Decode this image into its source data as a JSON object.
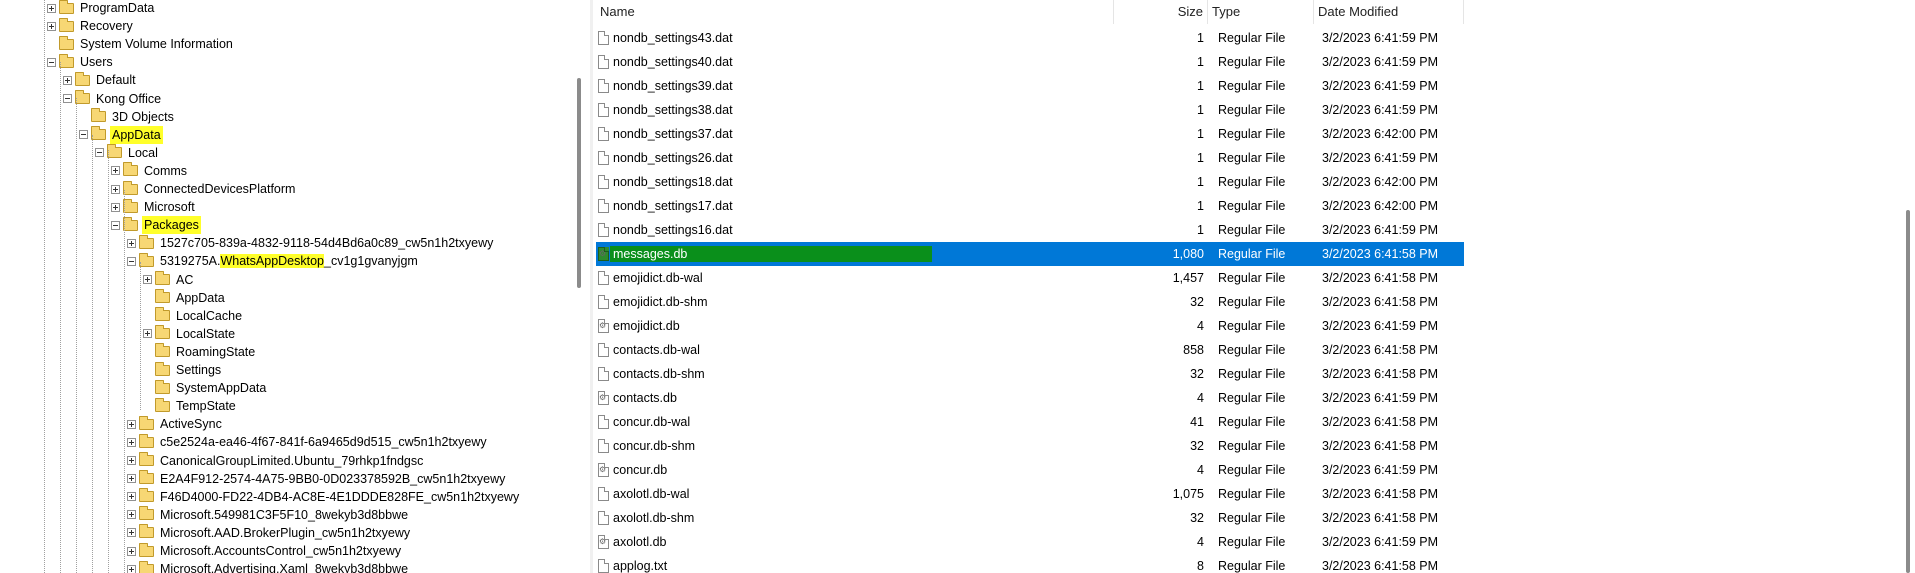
{
  "tree": {
    "items": [
      {
        "label": "ProgramData",
        "expander": "plus",
        "hl": false
      },
      {
        "label": "Recovery",
        "expander": "plus",
        "hl": false
      },
      {
        "label": "System Volume Information",
        "expander": "none",
        "hl": false
      },
      {
        "label": "Users",
        "expander": "minus",
        "hl": false
      },
      {
        "label": "Default",
        "expander": "plus",
        "hl": false
      },
      {
        "label": "Kong Office",
        "expander": "minus",
        "hl": false
      },
      {
        "label": "3D Objects",
        "expander": "none",
        "hl": false
      },
      {
        "label": "AppData",
        "expander": "minus",
        "hl": true
      },
      {
        "label": "Local",
        "expander": "minus",
        "hl": false
      },
      {
        "label": "Comms",
        "expander": "plus",
        "hl": false
      },
      {
        "label": "ConnectedDevicesPlatform",
        "expander": "plus",
        "hl": false
      },
      {
        "label": "Microsoft",
        "expander": "plus",
        "hl": false
      },
      {
        "label": "Packages",
        "expander": "minus",
        "hl": true
      },
      {
        "label": "1527c705-839a-4832-9118-54d4Bd6a0c89_cw5n1h2txyewy",
        "expander": "plus",
        "hl": false
      },
      {
        "label_pre": "5319275A.",
        "label_hl": "WhatsAppDesktop",
        "label_post": "_cv1g1gvanyjgm",
        "expander": "minus",
        "hl": false
      },
      {
        "label": "AC",
        "expander": "plus",
        "hl": false
      },
      {
        "label": "AppData",
        "expander": "none",
        "hl": false
      },
      {
        "label": "LocalCache",
        "expander": "none",
        "hl": false
      },
      {
        "label": "LocalState",
        "expander": "plus",
        "hl": false
      },
      {
        "label": "RoamingState",
        "expander": "none",
        "hl": false
      },
      {
        "label": "Settings",
        "expander": "none",
        "hl": false
      },
      {
        "label": "SystemAppData",
        "expander": "none",
        "hl": false
      },
      {
        "label": "TempState",
        "expander": "none",
        "hl": false
      },
      {
        "label": "ActiveSync",
        "expander": "plus",
        "hl": false
      },
      {
        "label": "c5e2524a-ea46-4f67-841f-6a9465d9d515_cw5n1h2txyewy",
        "expander": "plus",
        "hl": false
      },
      {
        "label": "CanonicalGroupLimited.Ubuntu_79rhkp1fndgsc",
        "expander": "plus",
        "hl": false
      },
      {
        "label": "E2A4F912-2574-4A75-9BB0-0D023378592B_cw5n1h2txyewy",
        "expander": "plus",
        "hl": false
      },
      {
        "label": "F46D4000-FD22-4DB4-AC8E-4E1DDDE828FE_cw5n1h2txyewy",
        "expander": "plus",
        "hl": false
      },
      {
        "label": "Microsoft.549981C3F5F10_8wekyb3d8bbwe",
        "expander": "plus",
        "hl": false
      },
      {
        "label": "Microsoft.AAD.BrokerPlugin_cw5n1h2txyewy",
        "expander": "plus",
        "hl": false
      },
      {
        "label": "Microsoft.AccountsControl_cw5n1h2txyewy",
        "expander": "plus",
        "hl": false
      },
      {
        "label": "Microsoft.Advertising.Xaml_8wekyb3d8bbwe",
        "expander": "plus",
        "hl": false
      }
    ]
  },
  "columns": {
    "name": "Name",
    "size": "Size",
    "type": "Type",
    "date": "Date Modified"
  },
  "files": [
    {
      "name": "nondb_settings43.dat",
      "size": "1",
      "type": "Regular File",
      "date": "3/2/2023 6:41:59 PM",
      "icon": "file"
    },
    {
      "name": "nondb_settings40.dat",
      "size": "1",
      "type": "Regular File",
      "date": "3/2/2023 6:41:59 PM",
      "icon": "file"
    },
    {
      "name": "nondb_settings39.dat",
      "size": "1",
      "type": "Regular File",
      "date": "3/2/2023 6:41:59 PM",
      "icon": "file"
    },
    {
      "name": "nondb_settings38.dat",
      "size": "1",
      "type": "Regular File",
      "date": "3/2/2023 6:41:59 PM",
      "icon": "file"
    },
    {
      "name": "nondb_settings37.dat",
      "size": "1",
      "type": "Regular File",
      "date": "3/2/2023 6:42:00 PM",
      "icon": "file"
    },
    {
      "name": "nondb_settings26.dat",
      "size": "1",
      "type": "Regular File",
      "date": "3/2/2023 6:41:59 PM",
      "icon": "file"
    },
    {
      "name": "nondb_settings18.dat",
      "size": "1",
      "type": "Regular File",
      "date": "3/2/2023 6:42:00 PM",
      "icon": "file"
    },
    {
      "name": "nondb_settings17.dat",
      "size": "1",
      "type": "Regular File",
      "date": "3/2/2023 6:42:00 PM",
      "icon": "file"
    },
    {
      "name": "nondb_settings16.dat",
      "size": "1",
      "type": "Regular File",
      "date": "3/2/2023 6:41:59 PM",
      "icon": "file"
    },
    {
      "name": "messages.db",
      "size": "1,080",
      "type": "Regular File",
      "date": "3/2/2023 6:41:58 PM",
      "icon": "db",
      "selected": true
    },
    {
      "name": "emojidict.db-wal",
      "size": "1,457",
      "type": "Regular File",
      "date": "3/2/2023 6:41:58 PM",
      "icon": "file"
    },
    {
      "name": "emojidict.db-shm",
      "size": "32",
      "type": "Regular File",
      "date": "3/2/2023 6:41:58 PM",
      "icon": "file"
    },
    {
      "name": "emojidict.db",
      "size": "4",
      "type": "Regular File",
      "date": "3/2/2023 6:41:59 PM",
      "icon": "db"
    },
    {
      "name": "contacts.db-wal",
      "size": "858",
      "type": "Regular File",
      "date": "3/2/2023 6:41:58 PM",
      "icon": "file"
    },
    {
      "name": "contacts.db-shm",
      "size": "32",
      "type": "Regular File",
      "date": "3/2/2023 6:41:58 PM",
      "icon": "file"
    },
    {
      "name": "contacts.db",
      "size": "4",
      "type": "Regular File",
      "date": "3/2/2023 6:41:59 PM",
      "icon": "db"
    },
    {
      "name": "concur.db-wal",
      "size": "41",
      "type": "Regular File",
      "date": "3/2/2023 6:41:58 PM",
      "icon": "file"
    },
    {
      "name": "concur.db-shm",
      "size": "32",
      "type": "Regular File",
      "date": "3/2/2023 6:41:58 PM",
      "icon": "file"
    },
    {
      "name": "concur.db",
      "size": "4",
      "type": "Regular File",
      "date": "3/2/2023 6:41:59 PM",
      "icon": "db"
    },
    {
      "name": "axolotl.db-wal",
      "size": "1,075",
      "type": "Regular File",
      "date": "3/2/2023 6:41:58 PM",
      "icon": "file"
    },
    {
      "name": "axolotl.db-shm",
      "size": "32",
      "type": "Regular File",
      "date": "3/2/2023 6:41:58 PM",
      "icon": "file"
    },
    {
      "name": "axolotl.db",
      "size": "4",
      "type": "Regular File",
      "date": "3/2/2023 6:41:59 PM",
      "icon": "db"
    },
    {
      "name": "applog.txt",
      "size": "8",
      "type": "Regular File",
      "date": "3/2/2023 6:41:58 PM",
      "icon": "file"
    }
  ]
}
